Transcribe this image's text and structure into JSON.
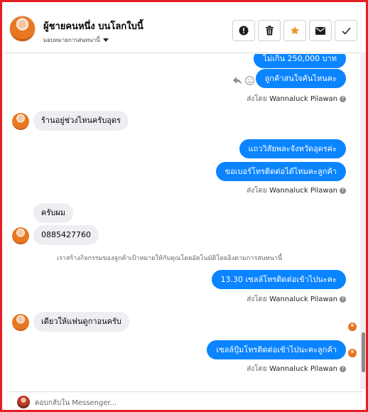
{
  "header": {
    "contact_name": "ผู้ชายคนหนึ่ง บนโลกใบนี้",
    "assign_label": "มอบหมายการสนทนานี้",
    "toolbar": {
      "spam_icon": "alert-circle-icon",
      "delete_icon": "trash-icon",
      "star_icon": "star-icon",
      "email_icon": "envelope-icon",
      "done_icon": "checkmark-icon"
    }
  },
  "messages": [
    {
      "dir": "out",
      "text": "ไม่เกิน 250,000 บาท"
    },
    {
      "dir": "out",
      "text": "ลูกค้าสนใจคันไหนคะ"
    },
    {
      "dir": "sent_by",
      "prefix": "ส่งโดย",
      "name": "Wannaluck Pilawan"
    },
    {
      "dir": "in",
      "text": "ร้านอยู่ช่วงไหนครับอุดร"
    },
    {
      "dir": "out",
      "text": "แถววิสัยพละจังหวัดอุดรค่ะ"
    },
    {
      "dir": "out",
      "text": "ขอเบอร์โทรติดต่อได้ไหมคะลูกค้า"
    },
    {
      "dir": "sent_by",
      "prefix": "ส่งโดย",
      "name": "Wannaluck Pilawan"
    },
    {
      "dir": "in",
      "text": "ครับผม"
    },
    {
      "dir": "in",
      "text": "0885427760"
    },
    {
      "dir": "system",
      "text": "เราสร้างกิจกรรมของลูกค้าเป้าหมายให้กับคุณโดยอัตโนมัติโดยอิงตามการสนทนานี้"
    },
    {
      "dir": "out",
      "text": "13.30  เซลล์โทรติดต่อเข้าไปนะคะ"
    },
    {
      "dir": "sent_by",
      "prefix": "ส่งโดย",
      "name": "Wannaluck Pilawan"
    },
    {
      "dir": "in",
      "text": "เดียวให้แฟนดูกาอนครับ"
    },
    {
      "dir": "out",
      "text": "เซลล์ปุ้มโทรติดต่อเข้าไปนะคะลูกค้า"
    },
    {
      "dir": "sent_by",
      "prefix": "ส่งโดย",
      "name": "Wannaluck Pilawan"
    }
  ],
  "reply": {
    "placeholder": "ตอบกลับใน Messenger..."
  },
  "colors": {
    "frame": "#e41e26",
    "outgoing_bubble": "#0a84ff",
    "incoming_bubble": "#eceef1",
    "star": "#f0932b"
  }
}
